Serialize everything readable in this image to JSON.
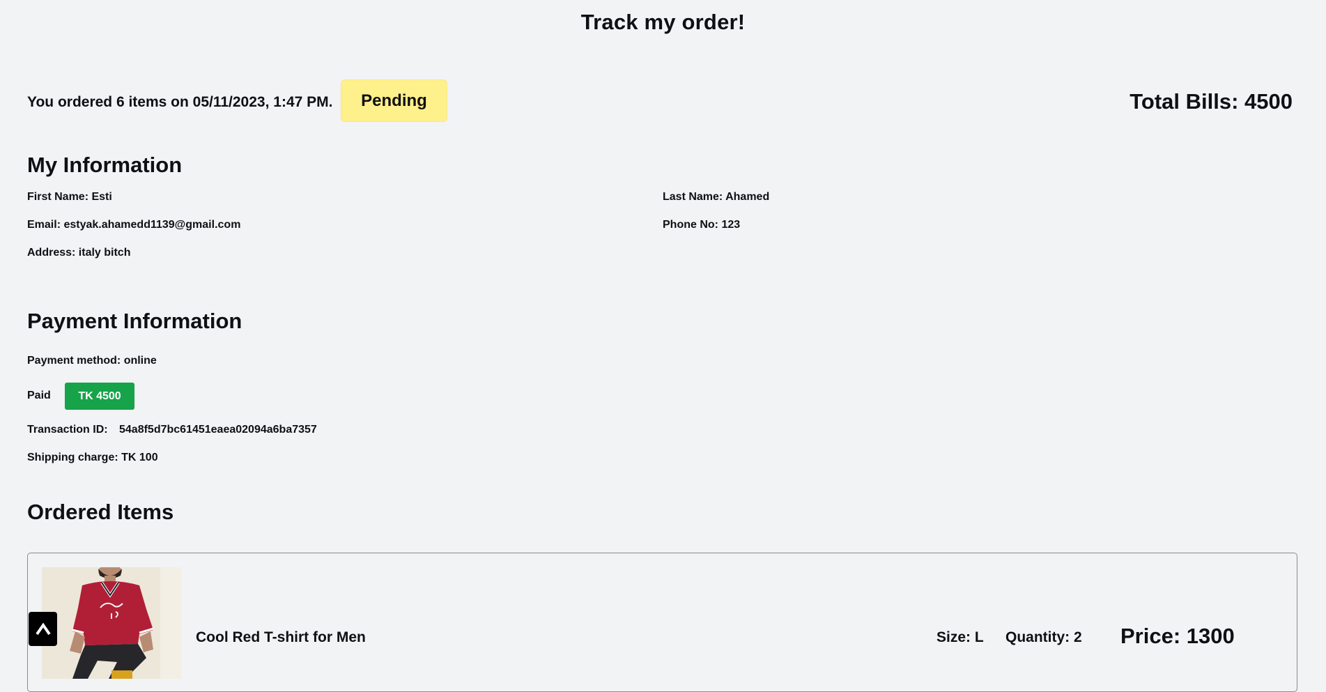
{
  "page": {
    "title": "Track my order!"
  },
  "order_summary": {
    "text": "You ordered 6 items on 05/11/2023, 1:47 PM.",
    "status": "Pending",
    "total_bills": "Total Bills: 4500"
  },
  "my_information": {
    "heading": "My Information",
    "first_name": "First Name: Esti",
    "last_name": "Last Name: Ahamed",
    "email": "Email: estyak.ahamedd1139@gmail.com",
    "phone": "Phone No: 123",
    "address": "Address: italy bitch"
  },
  "payment_information": {
    "heading": "Payment Information",
    "method": "Payment method: online",
    "paid_label": "Paid",
    "paid_amount": "TK 4500",
    "transaction_label": "Transaction ID:",
    "transaction_id": "54a8f5d7bc61451eaea02094a6ba7357",
    "shipping_charge": "Shipping charge: TK 100"
  },
  "ordered_items": {
    "heading": "Ordered Items",
    "items": [
      {
        "name": "Cool Red T-shirt for Men",
        "size": "Size: L",
        "quantity": "Quantity: 2",
        "price": "Price: 1300"
      }
    ]
  },
  "scroll_top": {
    "icon": "caret-up-icon",
    "glyph": "^"
  },
  "colors": {
    "background": "#f2f3f5",
    "pending_badge": "#fef08a",
    "paid_badge": "#16a34a",
    "scroll_button": "#000000"
  }
}
